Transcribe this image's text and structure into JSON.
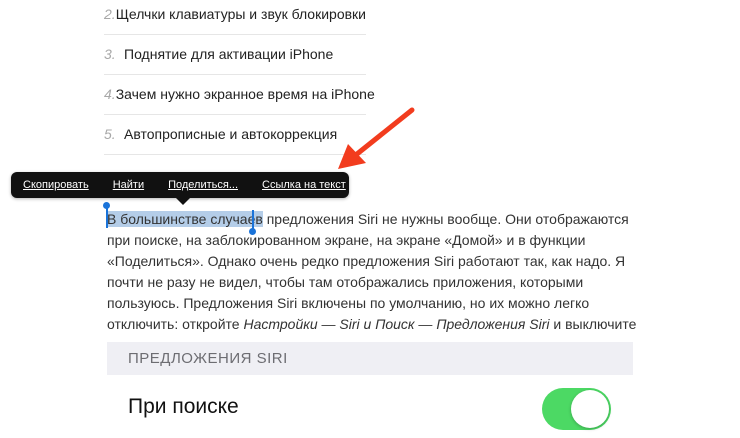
{
  "article_list": {
    "items": [
      {
        "num": "2.",
        "text": "Щелчки клавиатуры и звук блокировки"
      },
      {
        "num": "3.",
        "text": "Поднятие для активации iPhone"
      },
      {
        "num": "4.",
        "text": "Зачем нужно экранное время на iPhone"
      },
      {
        "num": "5.",
        "text": "Автопрописные и автокоррекция"
      }
    ]
  },
  "context_menu": {
    "copy": "Скопировать",
    "find": "Найти",
    "share": "Поделиться...",
    "link_to_text": "Ссылка на текст"
  },
  "paragraph": {
    "selected": "В большинстве случаев",
    "rest_1": " предложения Siri не нужны вообще. Они отображаются при поиске, на заблокированном экране, на экране «Домой» и в функции «Поделиться». Однако очень редко предложения Siri работают так, как надо. Я почти не разу не видел, чтобы там отображались приложения, которыми пользуюсь. Предложения Siri включены по умолчанию, но их можно легко отключить: откройте ",
    "italic": "Настройки — Siri и Поиск — Предложения Siri",
    "rest_2": " и выключите их."
  },
  "settings": {
    "section_header": "ПРЕДЛОЖЕНИЯ SIRI",
    "row_label": "При поиске",
    "toggle_on": true
  },
  "colors": {
    "toggle_on": "#4cd964",
    "annotation_arrow": "#f23c1e",
    "selection": "#b4cde8",
    "caret": "#1a73d9"
  }
}
